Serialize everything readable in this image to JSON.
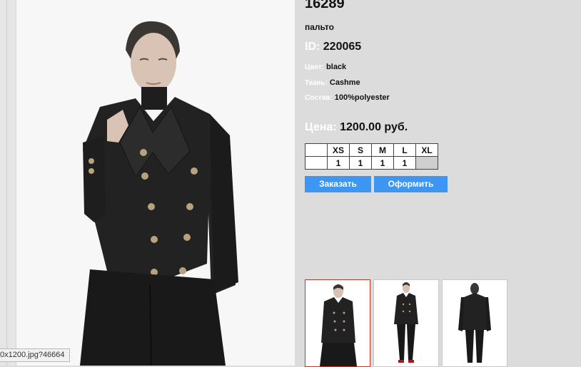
{
  "product": {
    "article": "16289",
    "type": "пальто",
    "id_label": "ID:",
    "id_value": "220065",
    "color_label": "Цвет:",
    "color_value": "black",
    "fabric_label": "Ткань:",
    "fabric_value": "Cashme",
    "composition_label": "Состав:",
    "composition_value": "100%polyester",
    "price_label": "Цена:",
    "price_value": "1200.00 руб."
  },
  "sizes": {
    "headers": [
      "",
      "XS",
      "S",
      "M",
      "L",
      "XL"
    ],
    "quantities": [
      "",
      "1",
      "1",
      "1",
      "1",
      ""
    ]
  },
  "buttons": {
    "order": "Заказать",
    "checkout": "Оформить"
  },
  "status_url": "0x1200.jpg?46664",
  "colors": {
    "button_bg": "#3c96f2",
    "panel_bg": "#dcdcdc",
    "active_thumb_border": "#c0392b"
  },
  "thumbnails": [
    {
      "view": "front-close-up",
      "active": true
    },
    {
      "view": "front-full-length",
      "active": false
    },
    {
      "view": "back-full-length",
      "active": false
    }
  ]
}
